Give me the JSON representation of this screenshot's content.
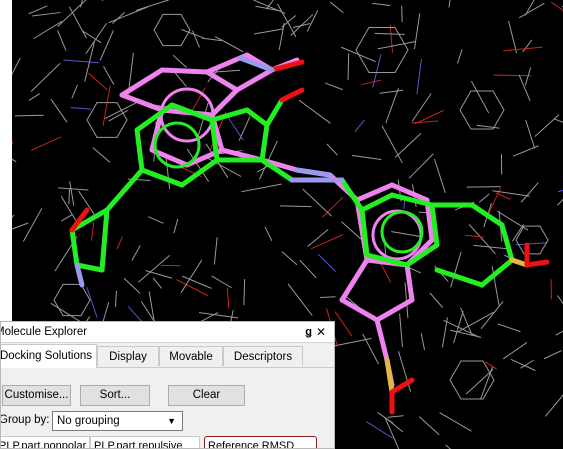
{
  "viewport": {
    "background": "#000000",
    "carbon_a": "#ee82ee",
    "carbon_b": "#22ee22",
    "nitrogen": "#9999ee",
    "oxygen": "#ee1111",
    "sulfur": "#ddbb44",
    "wire": "#9a9a9a"
  },
  "panel": {
    "title": "Molecule Explorer",
    "pin_icon": "pin-icon",
    "close_icon": "close-icon",
    "pin_glyph": "ǥ",
    "close_glyph": "✕",
    "tabs": [
      {
        "label": "Docking Solutions",
        "active": true
      },
      {
        "label": "Display"
      },
      {
        "label": "Movable"
      },
      {
        "label": "Descriptors"
      }
    ],
    "buttons": {
      "customise": "Customise...",
      "sort": "Sort...",
      "clear": "Clear"
    },
    "group_by_label": "Group by:",
    "group_by_value": "No grouping",
    "columns": [
      "PLP.part.nonpolar",
      "PLP.part.repulsive",
      "Reference RMSD"
    ]
  }
}
